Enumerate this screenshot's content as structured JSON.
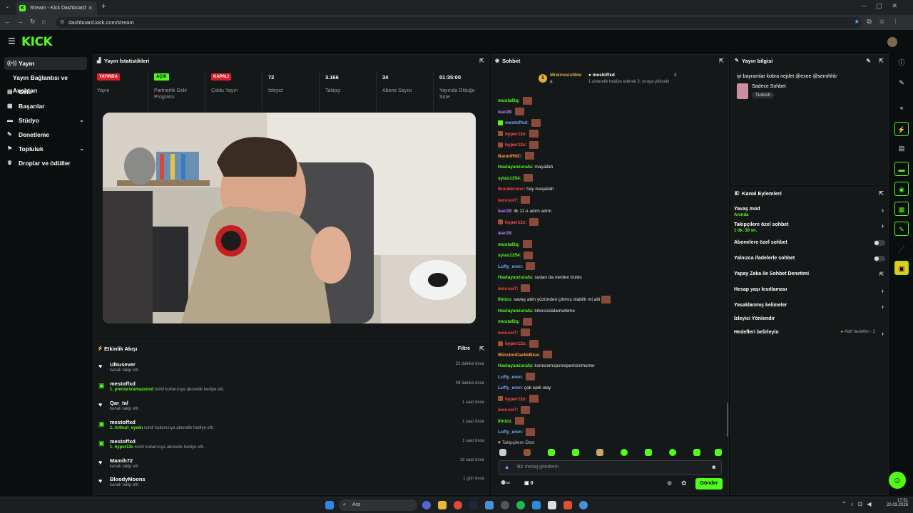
{
  "browser": {
    "tab_title": "Stream - Kick Dashboard",
    "url": "dashboard.kick.com/stream"
  },
  "brand": {
    "logo": "KICK",
    "accent": "#53fc18"
  },
  "sidebar": {
    "items": [
      {
        "label": "Yayın",
        "icon": "broadcast-icon"
      },
      {
        "label": "Yayın Bağlantısı ve Anahtarı",
        "icon": "key-icon"
      },
      {
        "label": "Gelir",
        "icon": "money-icon"
      },
      {
        "label": "Başarılar",
        "icon": "trophy-icon"
      },
      {
        "label": "Stüdyo",
        "icon": "studio-icon"
      },
      {
        "label": "Denetleme",
        "icon": "wrench-icon"
      },
      {
        "label": "Topluluk",
        "icon": "community-icon"
      },
      {
        "label": "Droplar ve ödüller",
        "icon": "gift-icon"
      }
    ]
  },
  "stats": {
    "title": "Yayın İstatistikleri",
    "items": [
      {
        "value": "YAYINDA",
        "label": "Yayın",
        "badge": "red"
      },
      {
        "value": "AÇIK",
        "label": "Partnerlik Gelir Programı",
        "badge": "green"
      },
      {
        "value": "KAPALI",
        "label": "Çoklu Yayın",
        "badge": "red"
      },
      {
        "value": "72",
        "label": "İzleyici"
      },
      {
        "value": "3.166",
        "label": "Takipçi"
      },
      {
        "value": "34",
        "label": "Abone Sayısı"
      },
      {
        "value": "01:35:00",
        "label": "Yayında Olduğu Süre"
      }
    ]
  },
  "activity": {
    "title": "Etkinlik Akışı",
    "filter": "Filtre",
    "items": [
      {
        "type": "follow",
        "name": "Ulkusever",
        "desc": "kanalı takip etti",
        "time": "22 dakika önce"
      },
      {
        "type": "gift",
        "name": "mestoffxd",
        "hl": "1. prensesramazanxd",
        "desc": "isimli kullanıcıya abonelik hediye etti.",
        "time": "48 dakika önce"
      },
      {
        "type": "follow",
        "name": "Qar_tal",
        "desc": "kanalı takip etti",
        "time": "1 saat önce"
      },
      {
        "type": "gift",
        "name": "mestoffxd",
        "hl": "1. Arthurl_eywin",
        "desc": "isimli kullanıcıya abonelik hediye etti.",
        "time": "1 saat önce"
      },
      {
        "type": "gift",
        "name": "mestoffxd",
        "hl": "1. hyper12x",
        "desc": "isimli kullanıcıya abonelik hediye etti.",
        "time": "1 saat önce"
      },
      {
        "type": "follow",
        "name": "Mamih72",
        "desc": "kanalı takip etti",
        "time": "19 saat önce"
      },
      {
        "type": "follow",
        "name": "BloodyMoons",
        "desc": "kanalı takip etti",
        "time": "1 gün önce"
      }
    ]
  },
  "chat": {
    "title": "Sohbet",
    "pinned": {
      "user1": "MrsIrresistible",
      "count1": "6",
      "user2": "mestoffxd",
      "count2": "3",
      "text": "1 abonelik hediye ederek 3. sıraya yükseltı"
    },
    "messages": [
      {
        "user": "mustaf2q",
        "color": "#53fc18",
        "text": "",
        "emote": true
      },
      {
        "user": "lear28",
        "color": "#b77cff",
        "text": "",
        "emote": true
      },
      {
        "user": "mestoffxd",
        "color": "#6fa8ff",
        "text": "",
        "emote": true,
        "badge": "#53fc18"
      },
      {
        "user": "hyper12x",
        "color": "#ff4d4d",
        "text": "",
        "emote": true,
        "badge": "#a0522d"
      },
      {
        "user": "hyper12x",
        "color": "#ff4d4d",
        "text": "",
        "emote": true,
        "badge": "#a0522d"
      },
      {
        "user": "BaranRNC",
        "color": "#ff9d3c",
        "text": "",
        "emote": true
      },
      {
        "user": "Havlayanzurafa",
        "color": "#53fc18",
        "text": "maşallah"
      },
      {
        "user": "syias1354",
        "color": "#53fc18",
        "text": "",
        "emote": true
      },
      {
        "user": "Burakkrater",
        "color": "#ff3f3f",
        "text": "hay maşallah"
      },
      {
        "user": "leonsol7",
        "color": "#ff3f3f",
        "text": "",
        "emote": true
      },
      {
        "user": "lear28",
        "color": "#b77cff",
        "text": "ilk 11 e adım adım"
      },
      {
        "user": "hyper12x",
        "color": "#ff4d4d",
        "text": "",
        "emote": true,
        "badge": "#a0522d"
      },
      {
        "user": "lear28",
        "color": "#b77cff",
        "text": ""
      },
      {
        "user": "mustaf2q",
        "color": "#53fc18",
        "text": "",
        "emote": true
      },
      {
        "user": "syias1354",
        "color": "#53fc18",
        "text": "",
        "emote": true
      },
      {
        "user": "Luffy_eren",
        "color": "#6fa8ff",
        "text": "",
        "emote": true
      },
      {
        "user": "Havlayanzurafa",
        "color": "#53fc18",
        "text": "sudan da nerden buldu"
      },
      {
        "user": "leonsol7",
        "color": "#ff3f3f",
        "text": "",
        "emote": true
      },
      {
        "user": "lllnizo",
        "color": "#53fc18",
        "text": "savaş abin yüzünden çıkmış olabilir mi abi",
        "emote": true
      },
      {
        "user": "Havlayanzurafa",
        "color": "#53fc18",
        "text": "krkesoslalamwlame"
      },
      {
        "user": "mustaf2q",
        "color": "#53fc18",
        "text": "",
        "emote": true
      },
      {
        "user": "leonsol7",
        "color": "#ff3f3f",
        "text": "",
        "emote": true
      },
      {
        "user": "hyper12x",
        "color": "#ff4d4d",
        "text": "",
        "emote": true,
        "badge": "#a0522d"
      },
      {
        "user": "WinstonDarkkBlue",
        "color": "#ff9d3c",
        "text": "",
        "emote": true
      },
      {
        "user": "Havlayanzurafa",
        "color": "#53fc18",
        "text": "ksneosmspsmspemslsmsmw"
      },
      {
        "user": "Luffy_eren",
        "color": "#6fa8ff",
        "text": "",
        "emote": true
      },
      {
        "user": "Luffy_eren",
        "color": "#6fa8ff",
        "text": "çok epik olay"
      },
      {
        "user": "hyper12x",
        "color": "#ff4d4d",
        "text": "",
        "emote": true,
        "badge": "#a0522d"
      },
      {
        "user": "leonsol7",
        "color": "#ff3f3f",
        "text": "",
        "emote": true
      },
      {
        "user": "lllnizo",
        "color": "#53fc18",
        "text": "",
        "emote": true
      },
      {
        "user": "Luffy_eren",
        "color": "#6fa8ff",
        "text": "",
        "emote": true
      }
    ],
    "followers_only": "Takipçilere Özel",
    "input_placeholder": "Bir mesaj gönderin",
    "points": "0",
    "send": "Gönder"
  },
  "stream_info": {
    "title": "Yayın bilgisi",
    "stream_title": "iyi bayramlar kobra nejdet @exee @semihhb",
    "category": "Sadece Sohbet",
    "tag": "Turkish"
  },
  "channel_actions": {
    "title": "Kanal Eylemleri",
    "items": [
      {
        "label": "Yavaş mod",
        "sub": "Anında",
        "control": "chevron"
      },
      {
        "label": "Takipçilere özel sohbet",
        "sub": "1 dk. 30 sn.",
        "control": "chevron"
      },
      {
        "label": "Abonelere özel sohbet",
        "control": "toggle"
      },
      {
        "label": "Yalnızca ifadelerle sohbet",
        "control": "toggle"
      },
      {
        "label": "Yapay Zeka ile Sohbet Denetimi",
        "control": "external"
      },
      {
        "label": "Hesap yaşı kısıtlaması",
        "control": "chevron"
      },
      {
        "label": "Yasaklanmış kelimeler",
        "control": "chevron"
      },
      {
        "label": "İzleyici Yönlendir",
        "control": "none"
      },
      {
        "label": "Hedefleri belirleyin",
        "extra": "Aktif hedefler - 2",
        "control": "chevron"
      }
    ]
  },
  "taskbar": {
    "search": "Ara",
    "time": "17:51",
    "date": "20.03.2026"
  }
}
